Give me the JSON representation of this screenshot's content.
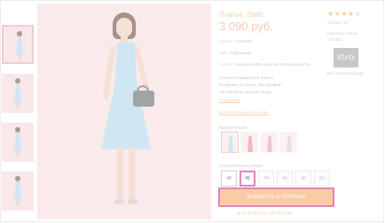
{
  "product": {
    "title": "Платье, Stets",
    "price": "3 090 руб.",
    "article_key": "Артикул:",
    "article": "2425463",
    "color_key": "Цвет:",
    "color": "бирюзовый",
    "composition_key": "Состав:",
    "composition": "полиэстер 80%,эластан 3%,вискоза 17%",
    "desc_line1": "Платье из бирюзовой ткани с",
    "desc_line2": "вставками по талии. Без рукавов с",
    "desc_line3": "застёжкой на молнию сзади.",
    "more_link": "Подробнее",
    "extra_desc": "Дополнительное описание"
  },
  "colors": {
    "label": "Выберите цвет:",
    "swatches": [
      "#a9d3ea",
      "#e57b86",
      "#e89aa2",
      "#d8c7c3"
    ]
  },
  "sizes": {
    "label": "Отечественный размер:",
    "items": [
      "40",
      "42",
      "44",
      "46",
      "48",
      "50"
    ],
    "selected": "42"
  },
  "actions": {
    "add_to_cart": "ДОБАВИТЬ В КОРЗИНУ",
    "notify": "♥  ОТЛОЖИТЬ НА ПОТОМ"
  },
  "sidebar": {
    "stars_on": "★★★★",
    "stars_off": "★",
    "reviews": "Отзывы: 67",
    "write_review": "Написать отзыв",
    "view_count": "Отзывов",
    "views": "105 560",
    "brand_logo": "Stets",
    "all_brand": "Все товары бренда"
  },
  "accent": {
    "orange": "#f6a35c",
    "highlight": "#d21e7a",
    "pink": "#f6d9dc"
  }
}
